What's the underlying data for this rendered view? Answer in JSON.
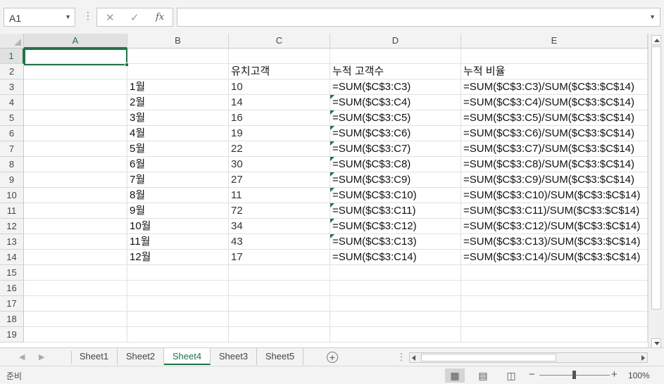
{
  "formula_bar": {
    "name_box": "A1",
    "cancel_icon": "✕",
    "enter_icon": "✓",
    "fx_label": "fx",
    "formula": ""
  },
  "columns": [
    "A",
    "B",
    "C",
    "D",
    "E"
  ],
  "rows": [
    {
      "n": "1",
      "b": "",
      "c": "",
      "d": "",
      "e": "",
      "tri": false
    },
    {
      "n": "2",
      "b": "",
      "c": "유치고객",
      "d": "누적 고객수",
      "e": "누적 비율",
      "tri": false
    },
    {
      "n": "3",
      "b": "1월",
      "c": "10",
      "d": "=SUM($C$3:C3)",
      "e": "=SUM($C$3:C3)/SUM($C$3:$C$14)",
      "tri": false
    },
    {
      "n": "4",
      "b": "2월",
      "c": "14",
      "d": "=SUM($C$3:C4)",
      "e": "=SUM($C$3:C4)/SUM($C$3:$C$14)",
      "tri": true
    },
    {
      "n": "5",
      "b": "3월",
      "c": "16",
      "d": "=SUM($C$3:C5)",
      "e": "=SUM($C$3:C5)/SUM($C$3:$C$14)",
      "tri": true
    },
    {
      "n": "6",
      "b": "4월",
      "c": "19",
      "d": "=SUM($C$3:C6)",
      "e": "=SUM($C$3:C6)/SUM($C$3:$C$14)",
      "tri": true
    },
    {
      "n": "7",
      "b": "5월",
      "c": "22",
      "d": "=SUM($C$3:C7)",
      "e": "=SUM($C$3:C7)/SUM($C$3:$C$14)",
      "tri": true
    },
    {
      "n": "8",
      "b": "6월",
      "c": "30",
      "d": "=SUM($C$3:C8)",
      "e": "=SUM($C$3:C8)/SUM($C$3:$C$14)",
      "tri": true
    },
    {
      "n": "9",
      "b": "7월",
      "c": "27",
      "d": "=SUM($C$3:C9)",
      "e": "=SUM($C$3:C9)/SUM($C$3:$C$14)",
      "tri": true
    },
    {
      "n": "10",
      "b": "8월",
      "c": "11",
      "d": "=SUM($C$3:C10)",
      "e": "=SUM($C$3:C10)/SUM($C$3:$C$14)",
      "tri": true
    },
    {
      "n": "11",
      "b": "9월",
      "c": "72",
      "d": "=SUM($C$3:C11)",
      "e": "=SUM($C$3:C11)/SUM($C$3:$C$14)",
      "tri": true
    },
    {
      "n": "12",
      "b": "10월",
      "c": "34",
      "d": "=SUM($C$3:C12)",
      "e": "=SUM($C$3:C12)/SUM($C$3:$C$14)",
      "tri": true
    },
    {
      "n": "13",
      "b": "11월",
      "c": "43",
      "d": "=SUM($C$3:C13)",
      "e": "=SUM($C$3:C13)/SUM($C$3:$C$14)",
      "tri": true
    },
    {
      "n": "14",
      "b": "12월",
      "c": "17",
      "d": "=SUM($C$3:C14)",
      "e": "=SUM($C$3:C14)/SUM($C$3:$C$14)",
      "tri": false
    },
    {
      "n": "15",
      "b": "",
      "c": "",
      "d": "",
      "e": "",
      "tri": false
    },
    {
      "n": "16",
      "b": "",
      "c": "",
      "d": "",
      "e": "",
      "tri": false
    },
    {
      "n": "17",
      "b": "",
      "c": "",
      "d": "",
      "e": "",
      "tri": false
    },
    {
      "n": "18",
      "b": "",
      "c": "",
      "d": "",
      "e": "",
      "tri": false
    },
    {
      "n": "19",
      "b": "",
      "c": "",
      "d": "",
      "e": "",
      "tri": false
    }
  ],
  "sheet_tabs": [
    {
      "label": "Sheet1",
      "active": false
    },
    {
      "label": "Sheet2",
      "active": false
    },
    {
      "label": "Sheet4",
      "active": true
    },
    {
      "label": "Sheet3",
      "active": false
    },
    {
      "label": "Sheet5",
      "active": false
    }
  ],
  "add_sheet_icon": "+",
  "status_bar": {
    "ready": "준비",
    "zoom_minus": "−",
    "zoom_plus": "+",
    "zoom": "100%"
  },
  "colors": {
    "accent": "#217346",
    "header_bg": "#f3f3f3",
    "gridline": "#e1e1e1"
  }
}
